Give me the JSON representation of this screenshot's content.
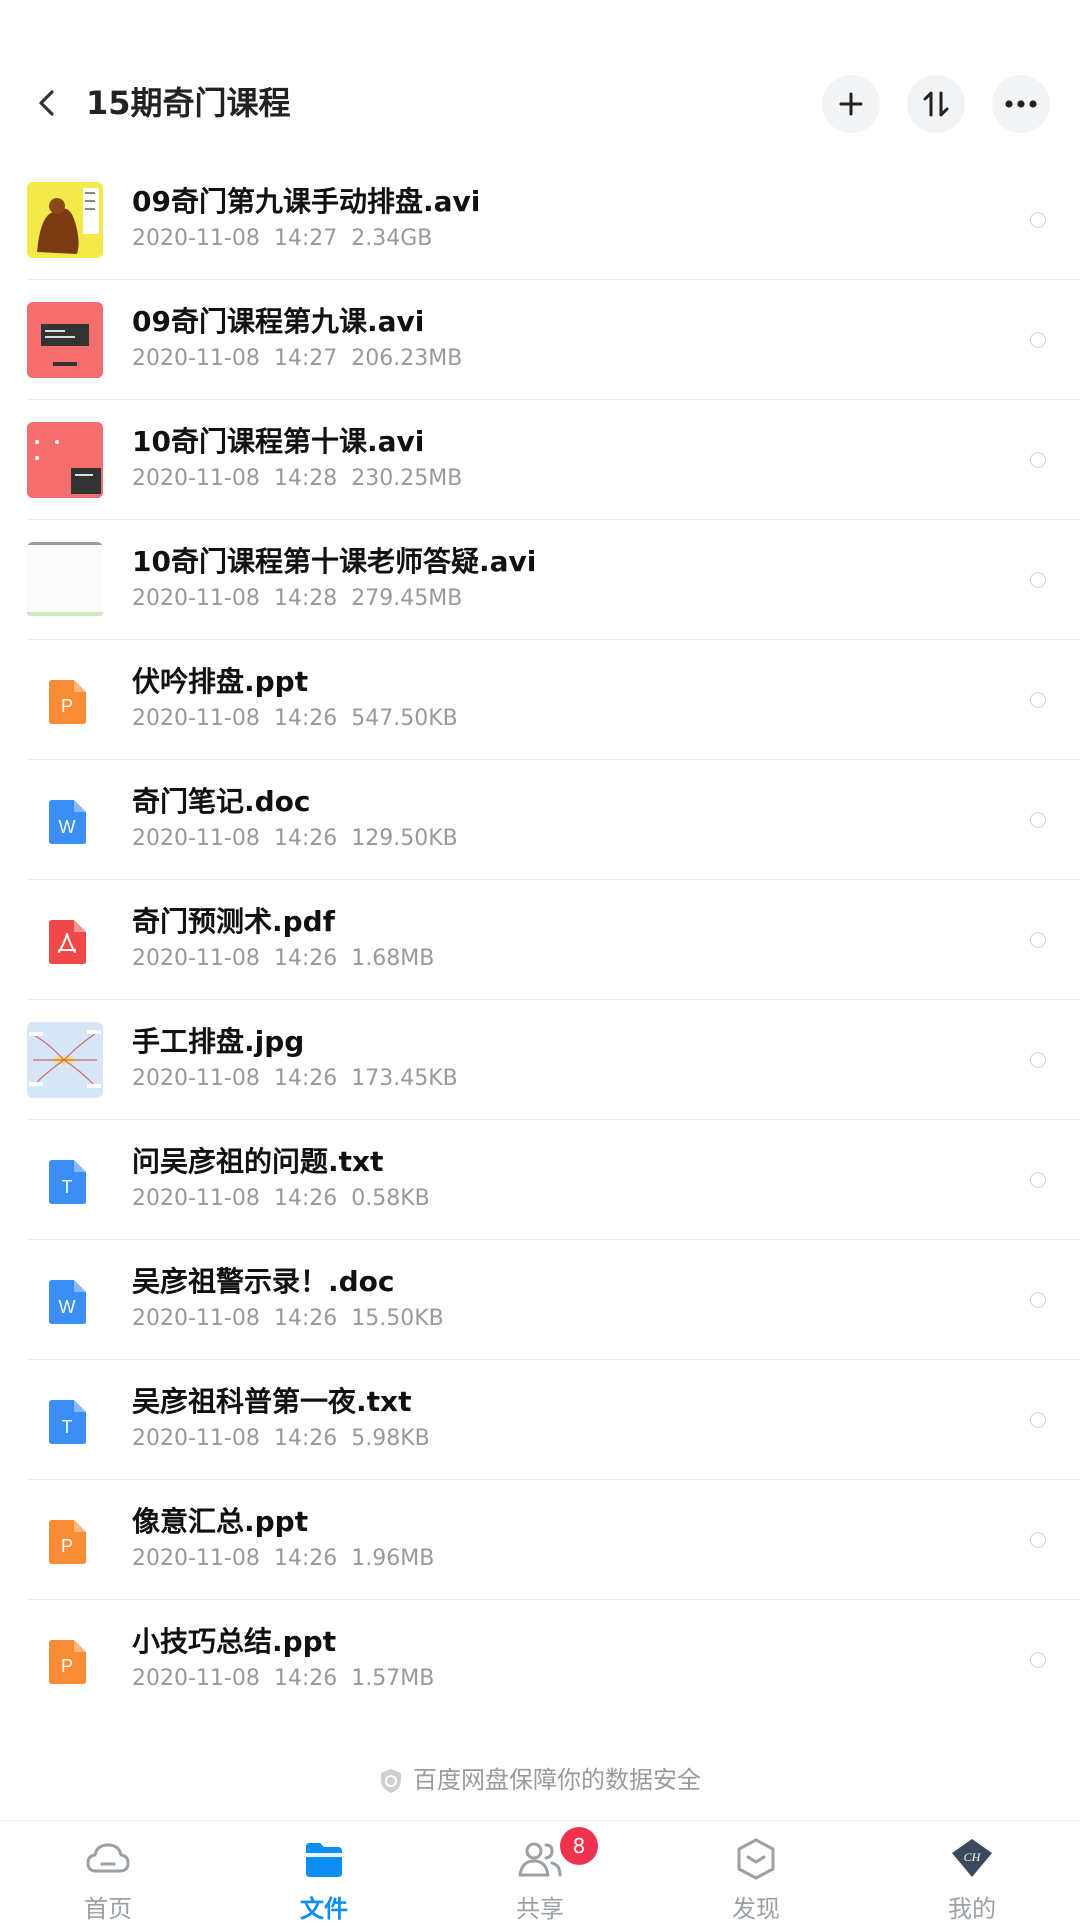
{
  "header": {
    "title": "15期奇门课程",
    "back_icon": "back-arrow-icon",
    "actions": [
      "add-icon",
      "sort-icon",
      "more-icon"
    ]
  },
  "files": [
    {
      "name": "09奇门第九课手动排盘.avi",
      "date": "2020-11-08",
      "time": "14:27",
      "size": "2.34GB",
      "kind": "video",
      "thumb": "yellow"
    },
    {
      "name": "09奇门课程第九课.avi",
      "date": "2020-11-08",
      "time": "14:27",
      "size": "206.23MB",
      "kind": "video",
      "thumb": "red"
    },
    {
      "name": "10奇门课程第十课.avi",
      "date": "2020-11-08",
      "time": "14:28",
      "size": "230.25MB",
      "kind": "video",
      "thumb": "red2"
    },
    {
      "name": "10奇门课程第十课老师答疑.avi",
      "date": "2020-11-08",
      "time": "14:28",
      "size": "279.45MB",
      "kind": "video",
      "thumb": "white"
    },
    {
      "name": "伏吟排盘.ppt",
      "date": "2020-11-08",
      "time": "14:26",
      "size": "547.50KB",
      "kind": "ppt"
    },
    {
      "name": "奇门笔记.doc",
      "date": "2020-11-08",
      "time": "14:26",
      "size": "129.50KB",
      "kind": "doc"
    },
    {
      "name": "奇门预测术.pdf",
      "date": "2020-11-08",
      "time": "14:26",
      "size": "1.68MB",
      "kind": "pdf"
    },
    {
      "name": "手工排盘.jpg",
      "date": "2020-11-08",
      "time": "14:26",
      "size": "173.45KB",
      "kind": "image",
      "thumb": "mindmap"
    },
    {
      "name": "问吴彦祖的问题.txt",
      "date": "2020-11-08",
      "time": "14:26",
      "size": "0.58KB",
      "kind": "txt"
    },
    {
      "name": "吴彦祖警示录！.doc",
      "date": "2020-11-08",
      "time": "14:26",
      "size": "15.50KB",
      "kind": "doc"
    },
    {
      "name": "吴彦祖科普第一夜.txt",
      "date": "2020-11-08",
      "time": "14:26",
      "size": "5.98KB",
      "kind": "txt"
    },
    {
      "name": "像意汇总.ppt",
      "date": "2020-11-08",
      "time": "14:26",
      "size": "1.96MB",
      "kind": "ppt"
    },
    {
      "name": "小技巧总结.ppt",
      "date": "2020-11-08",
      "time": "14:26",
      "size": "1.57MB",
      "kind": "ppt"
    }
  ],
  "file_type_letters": {
    "ppt": "P",
    "doc": "W",
    "txt": "T"
  },
  "file_type_colors": {
    "ppt": "#fa8c35",
    "doc": "#3a8ef6",
    "txt": "#3a8ef6",
    "pdf": "#f04848"
  },
  "notice": "百度网盘保障你的数据安全",
  "nav": {
    "items": [
      {
        "label": "首页",
        "icon": "cloud-icon",
        "active": false
      },
      {
        "label": "文件",
        "icon": "folder-icon",
        "active": true
      },
      {
        "label": "共享",
        "icon": "people-icon",
        "active": false,
        "badge": "8"
      },
      {
        "label": "发现",
        "icon": "discover-icon",
        "active": false
      },
      {
        "label": "我的",
        "icon": "avatar-icon",
        "active": false,
        "avatar_text": "CH"
      }
    ]
  },
  "colors": {
    "accent": "#0b8ef5",
    "badge": "#f0324f"
  }
}
